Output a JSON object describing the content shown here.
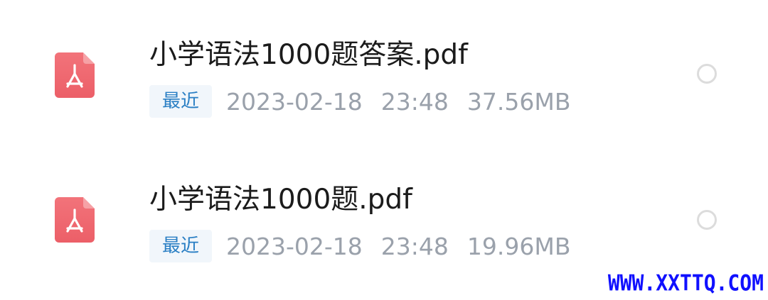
{
  "colors": {
    "pdf_icon": "#f06a72",
    "badge_bg": "#f1f6fb",
    "badge_text": "#2a7fc4",
    "meta_text": "#9aa1ab",
    "watermark": "#1010ff"
  },
  "files": [
    {
      "name": "小学语法1000题答案.pdf",
      "badge": "最近",
      "date": "2023-02-18",
      "time": "23:48",
      "size": "37.56MB",
      "icon": "pdf-icon",
      "selected": false
    },
    {
      "name": "小学语法1000题.pdf",
      "badge": "最近",
      "date": "2023-02-18",
      "time": "23:48",
      "size": "19.96MB",
      "icon": "pdf-icon",
      "selected": false
    }
  ],
  "watermark": "WWW.XXTTQ.COM"
}
